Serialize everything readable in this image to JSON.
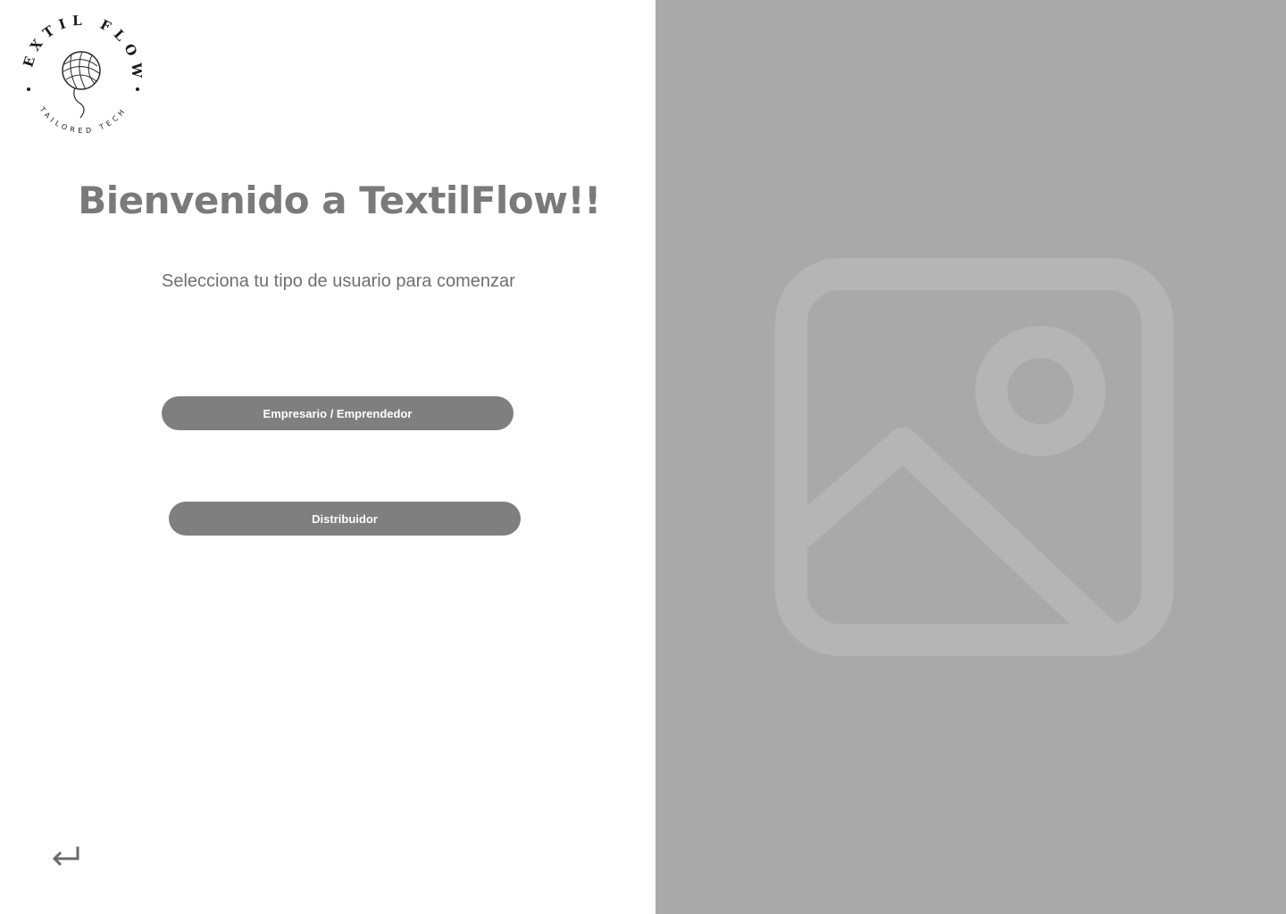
{
  "logo": {
    "brand_text": "TEXTIL FLOW",
    "tagline": "TAILORED TECH",
    "icon": "yarn-ball-icon"
  },
  "welcome": {
    "title": "Bienvenido a TextilFlow!!",
    "subtitle": "Selecciona tu tipo de usuario para comenzar"
  },
  "buttons": {
    "entrepreneur_label": "Empresario / Emprendedor",
    "distributor_label": "Distribuidor"
  },
  "navigation": {
    "back_icon": "return-arrow-icon"
  },
  "hero": {
    "image_icon": "image-placeholder-icon"
  },
  "colors": {
    "title_text": "#7a7a7a",
    "subtitle_text": "#6f6f6f",
    "button_bg": "#7f7f7f",
    "button_text": "#ffffff",
    "right_panel_bg": "#a9a9a9",
    "placeholder_stroke": "#b5b5b5"
  }
}
